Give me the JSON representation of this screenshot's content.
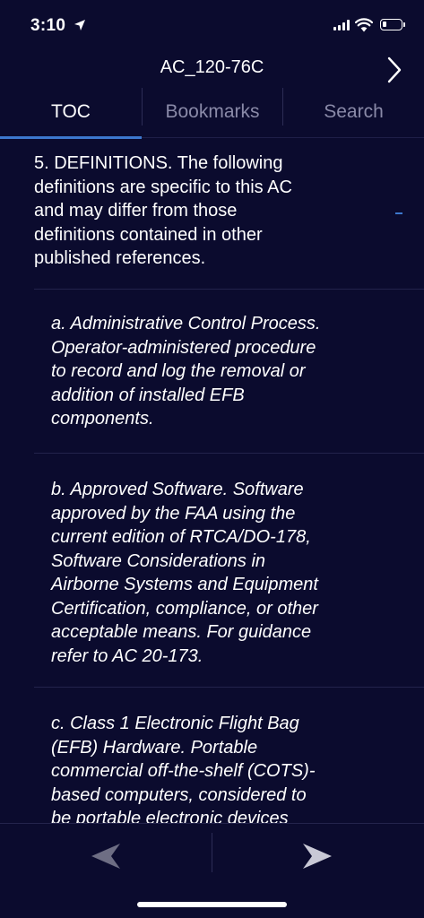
{
  "status_bar": {
    "time": "3:10",
    "icons": [
      "location-arrow-icon",
      "cellular-signal-icon",
      "wifi-icon",
      "battery-icon"
    ]
  },
  "nav": {
    "title": "AC_120-76C",
    "forward_icon": "chevron-right-icon"
  },
  "tabs": [
    {
      "label": "TOC",
      "active": true
    },
    {
      "label": "Bookmarks",
      "active": false
    },
    {
      "label": "Search",
      "active": false
    }
  ],
  "sections": [
    {
      "text": "5. DEFINITIONS. The following definitions are specific to this AC and may differ from those definitions contained in other published references.",
      "lines": [
        "5. DEFINITIONS. The following",
        "definitions are specific to this AC",
        "and may differ from those",
        "definitions contained in other",
        "published references."
      ]
    },
    {
      "text": "a. Administrative Control Process. Operator-administered procedure to record and log the removal or addition of installed EFB components.",
      "lines": [
        "a. Administrative Control Process.",
        "Operator-administered procedure",
        "to record and log the removal or",
        "addition of installed EFB",
        "components."
      ]
    },
    {
      "text": "b. Approved Software. Software approved by the FAA using the current edition of RTCA/DO-178, Software Considerations in Airborne Systems and Equipment Certification, compliance, or other acceptable means. For guidance refer to AC 20-173.",
      "lines": [
        "b. Approved Software. Software",
        "approved by the FAA using the",
        "current edition of RTCA/DO-178,",
        "Software Considerations in",
        "Airborne Systems and Equipment",
        "Certification, compliance, or other",
        "acceptable means. For guidance",
        "refer to AC 20-173."
      ]
    },
    {
      "text": "c. Class 1 Electronic Flight Bag (EFB) Hardware. Portable commercial off-the-shelf (COTS)-based computers, considered to be portable electronic devices",
      "lines": [
        "c. Class 1 Electronic Flight Bag",
        "(EFB) Hardware. Portable",
        "commercial off-the-shelf (COTS)-",
        "based computers, considered to",
        "be portable electronic devices"
      ]
    }
  ],
  "toolbar": {
    "back_icon": "triangle-left-icon",
    "forward_icon": "triangle-right-icon"
  },
  "colors": {
    "background": "#0b0b2e",
    "accent": "#3d78ce",
    "inactive_text": "#8a8aa8",
    "divider": "#23234c",
    "disabled_icon": "#6e6e84",
    "enabled_icon": "#c9c9d6"
  }
}
